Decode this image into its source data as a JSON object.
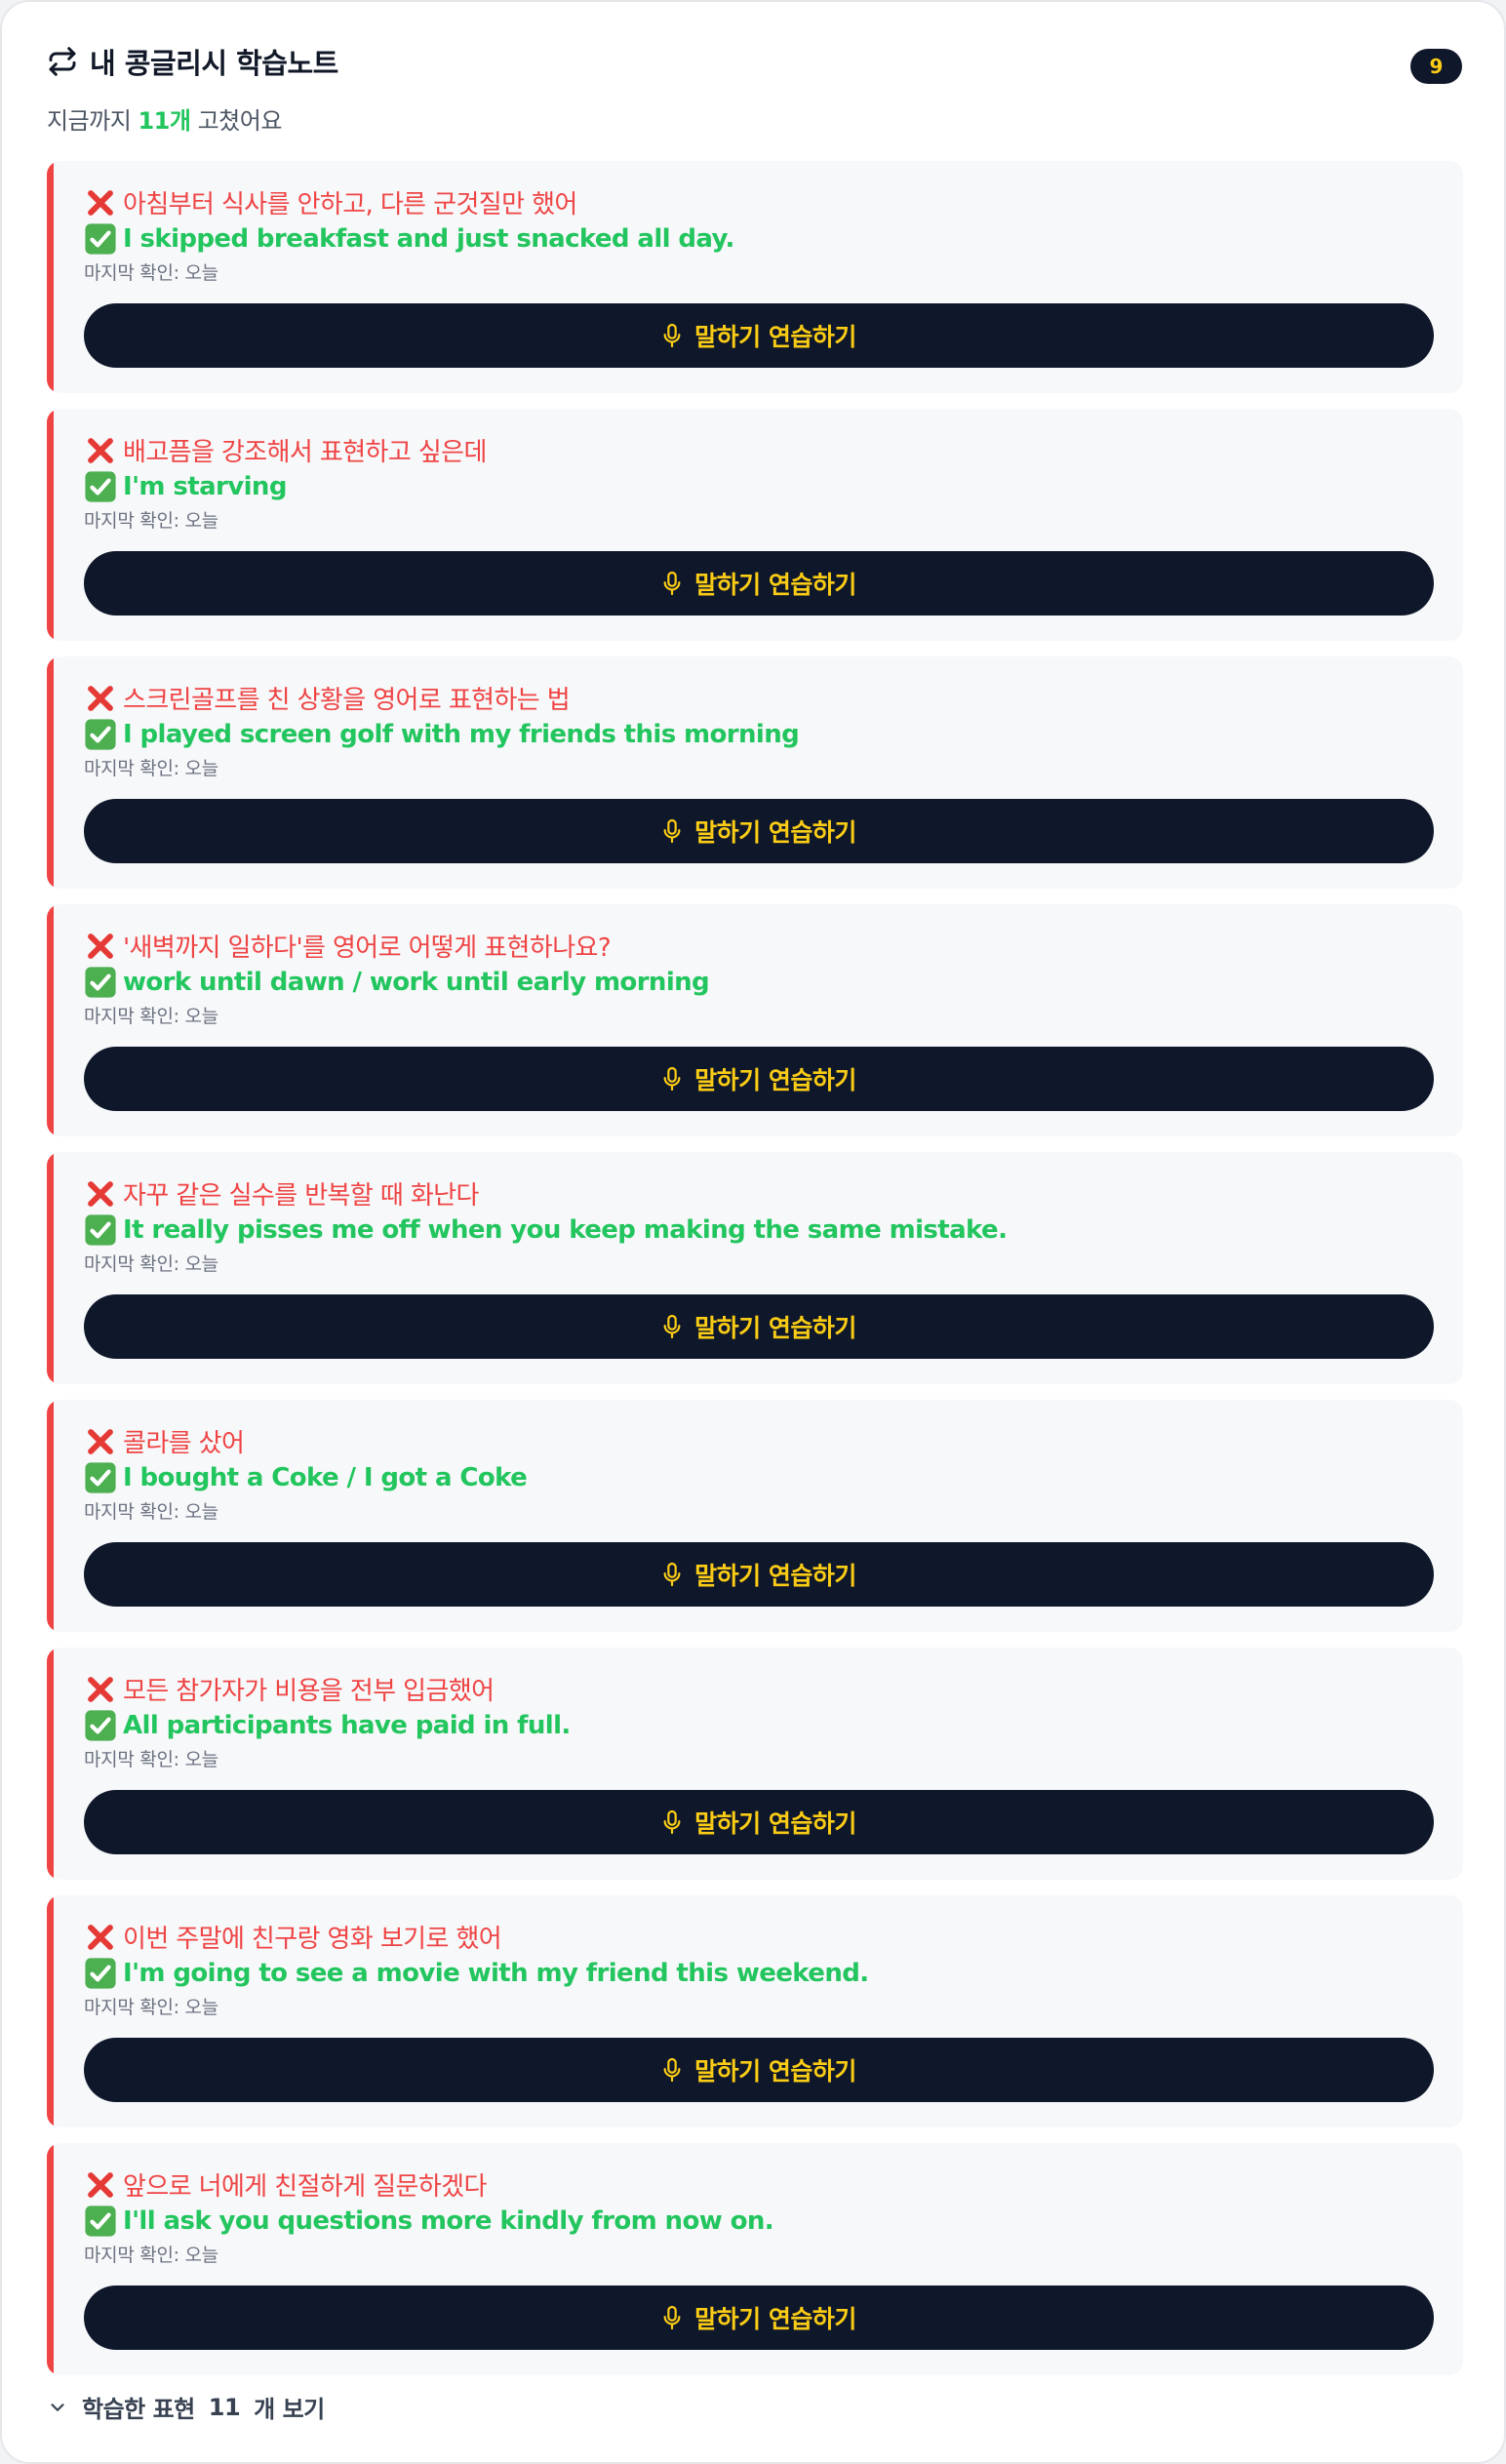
{
  "header": {
    "title": "내 콩글리시 학습노트",
    "badge_count": "9",
    "subtitle_prefix": "지금까지",
    "subtitle_count": "11개",
    "subtitle_suffix": "고쳤어요"
  },
  "icons": {
    "title_icon": "repeat-icon",
    "wrong_icon": "cross-mark-icon",
    "right_icon": "check-mark-icon",
    "button_icon": "microphone-icon",
    "footer_icon": "chevron-down-icon"
  },
  "colors": {
    "accent_bar": "#ef4444",
    "wrong_text": "#ef4444",
    "right_text": "#22c55e",
    "button_bg": "#0f172a",
    "button_text": "#facc15"
  },
  "cards": [
    {
      "wrong": "아침부터 식사를 안하고, 다른 군것질만 했어",
      "right": "I skipped breakfast and just snacked all day.",
      "meta": "마지막 확인: 오늘",
      "button": "말하기 연습하기"
    },
    {
      "wrong": "배고픔을 강조해서 표현하고 싶은데",
      "right": "I'm starving",
      "meta": "마지막 확인: 오늘",
      "button": "말하기 연습하기"
    },
    {
      "wrong": "스크린골프를 친 상황을 영어로 표현하는 법",
      "right": "I played screen golf with my friends this morning",
      "meta": "마지막 확인: 오늘",
      "button": "말하기 연습하기"
    },
    {
      "wrong": "'새벽까지 일하다'를 영어로 어떻게 표현하나요?",
      "right": "work until dawn / work until early morning",
      "meta": "마지막 확인: 오늘",
      "button": "말하기 연습하기"
    },
    {
      "wrong": "자꾸 같은 실수를 반복할 때 화난다",
      "right": "It really pisses me off when you keep making the same mistake.",
      "meta": "마지막 확인: 오늘",
      "button": "말하기 연습하기"
    },
    {
      "wrong": "콜라를 샀어",
      "right": "I bought a Coke / I got a Coke",
      "meta": "마지막 확인: 오늘",
      "button": "말하기 연습하기"
    },
    {
      "wrong": "모든 참가자가 비용을 전부 입금했어",
      "right": "All participants have paid in full.",
      "meta": "마지막 확인: 오늘",
      "button": "말하기 연습하기"
    },
    {
      "wrong": "이번 주말에 친구랑 영화 보기로 했어",
      "right": "I'm going to see a movie with my friend this weekend.",
      "meta": "마지막 확인: 오늘",
      "button": "말하기 연습하기"
    },
    {
      "wrong": "앞으로 너에게 친절하게 질문하겠다",
      "right": "I'll ask you questions more kindly from now on.",
      "meta": "마지막 확인: 오늘",
      "button": "말하기 연습하기"
    }
  ],
  "footer": {
    "label_prefix": "학습한 표현",
    "count": "11",
    "label_suffix": "개 보기"
  }
}
